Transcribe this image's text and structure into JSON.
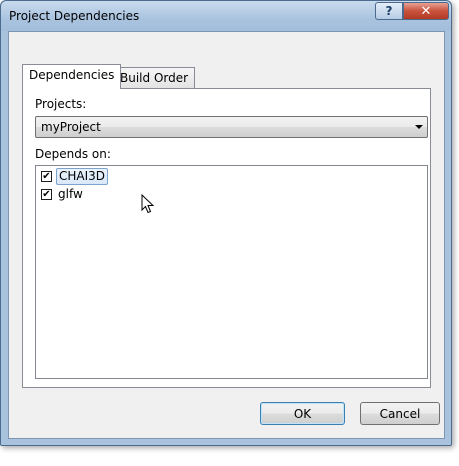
{
  "window": {
    "title": "Project Dependencies",
    "help_glyph": "?",
    "close_glyph": "✕"
  },
  "tabs": [
    {
      "label": "Dependencies",
      "active": true
    },
    {
      "label": "Build Order",
      "active": false
    }
  ],
  "projects": {
    "label": "Projects:",
    "selected": "myProject"
  },
  "depends_on": {
    "label": "Depends on:",
    "items": [
      {
        "label": "CHAI3D",
        "checked": true,
        "focused": true
      },
      {
        "label": "glfw",
        "checked": true,
        "focused": false
      }
    ]
  },
  "buttons": {
    "ok": "OK",
    "cancel": "Cancel"
  },
  "colors": {
    "titlebar": "#a9c3df",
    "close_button": "#c9523d",
    "dialog_background": "#f0f0f0"
  }
}
